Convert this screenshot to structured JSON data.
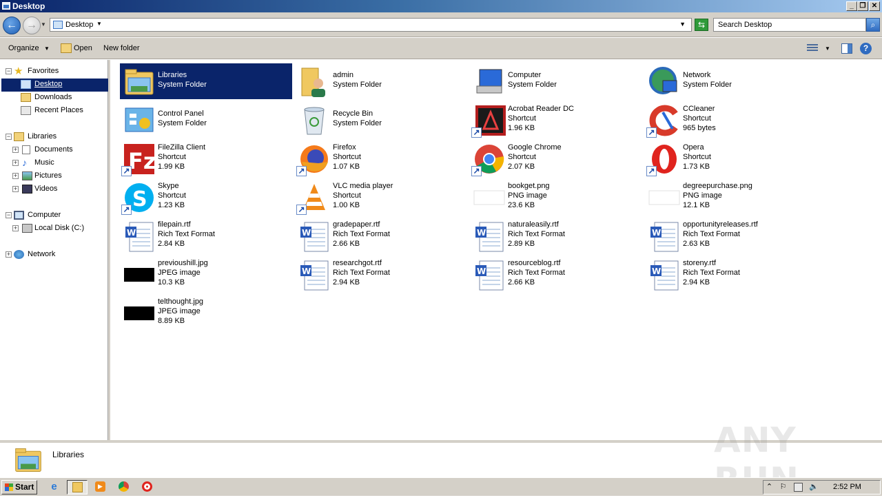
{
  "window": {
    "title": "Desktop"
  },
  "address": {
    "path": "Desktop",
    "search_placeholder": "Search Desktop"
  },
  "toolbar": {
    "organize": "Organize",
    "open": "Open",
    "new_folder": "New folder"
  },
  "nav": {
    "favorites": "Favorites",
    "desktop": "Desktop",
    "downloads": "Downloads",
    "recent": "Recent Places",
    "libraries": "Libraries",
    "documents": "Documents",
    "music": "Music",
    "pictures": "Pictures",
    "videos": "Videos",
    "computer": "Computer",
    "local_disk": "Local Disk (C:)",
    "network": "Network"
  },
  "files": [
    {
      "name": "Libraries",
      "type": "System Folder",
      "size": "",
      "icon": "libraries-icon"
    },
    {
      "name": "admin",
      "type": "System Folder",
      "size": "",
      "icon": "user-folder-icon"
    },
    {
      "name": "Computer",
      "type": "System Folder",
      "size": "",
      "icon": "computer-icon"
    },
    {
      "name": "Network",
      "type": "System Folder",
      "size": "",
      "icon": "network-icon"
    },
    {
      "name": "Control Panel",
      "type": "System Folder",
      "size": "",
      "icon": "control-panel-icon"
    },
    {
      "name": "Recycle Bin",
      "type": "System Folder",
      "size": "",
      "icon": "recycle-bin-icon"
    },
    {
      "name": "Acrobat Reader DC",
      "type": "Shortcut",
      "size": "1.96 KB",
      "icon": "acrobat-icon"
    },
    {
      "name": "CCleaner",
      "type": "Shortcut",
      "size": "965 bytes",
      "icon": "ccleaner-icon"
    },
    {
      "name": "FileZilla Client",
      "type": "Shortcut",
      "size": "1.99 KB",
      "icon": "filezilla-icon"
    },
    {
      "name": "Firefox",
      "type": "Shortcut",
      "size": "1.07 KB",
      "icon": "firefox-icon"
    },
    {
      "name": "Google Chrome",
      "type": "Shortcut",
      "size": "2.07 KB",
      "icon": "chrome-icon"
    },
    {
      "name": "Opera",
      "type": "Shortcut",
      "size": "1.73 KB",
      "icon": "opera-icon"
    },
    {
      "name": "Skype",
      "type": "Shortcut",
      "size": "1.23 KB",
      "icon": "skype-icon"
    },
    {
      "name": "VLC media player",
      "type": "Shortcut",
      "size": "1.00 KB",
      "icon": "vlc-icon"
    },
    {
      "name": "bookget.png",
      "type": "PNG image",
      "size": "23.6 KB",
      "icon": "png-thumbnail-icon"
    },
    {
      "name": "degreepurchase.png",
      "type": "PNG image",
      "size": "12.1 KB",
      "icon": "png-thumbnail-icon"
    },
    {
      "name": "filepain.rtf",
      "type": "Rich Text Format",
      "size": "2.84 KB",
      "icon": "rtf-document-icon"
    },
    {
      "name": "gradepaper.rtf",
      "type": "Rich Text Format",
      "size": "2.66 KB",
      "icon": "rtf-document-icon"
    },
    {
      "name": "naturaleasily.rtf",
      "type": "Rich Text Format",
      "size": "2.89 KB",
      "icon": "rtf-document-icon"
    },
    {
      "name": "opportunityreleases.rtf",
      "type": "Rich Text Format",
      "size": "2.63 KB",
      "icon": "rtf-document-icon"
    },
    {
      "name": "previoushill.jpg",
      "type": "JPEG image",
      "size": "10.3 KB",
      "icon": "jpg-thumbnail-icon"
    },
    {
      "name": "researchgot.rtf",
      "type": "Rich Text Format",
      "size": "2.94 KB",
      "icon": "rtf-document-icon"
    },
    {
      "name": "resourceblog.rtf",
      "type": "Rich Text Format",
      "size": "2.66 KB",
      "icon": "rtf-document-icon"
    },
    {
      "name": "storeny.rtf",
      "type": "Rich Text Format",
      "size": "2.94 KB",
      "icon": "rtf-document-icon"
    },
    {
      "name": "telthought.jpg",
      "type": "JPEG image",
      "size": "8.89 KB",
      "icon": "jpg-thumbnail-icon"
    }
  ],
  "details": {
    "name": "Libraries"
  },
  "watermark": "ANY RUN",
  "taskbar": {
    "start": "Start",
    "clock": "2:52 PM"
  },
  "colors": {
    "selection": "#0a246a",
    "chrome": "#d4d0c8",
    "title_gradient_start": "#0a246a"
  }
}
